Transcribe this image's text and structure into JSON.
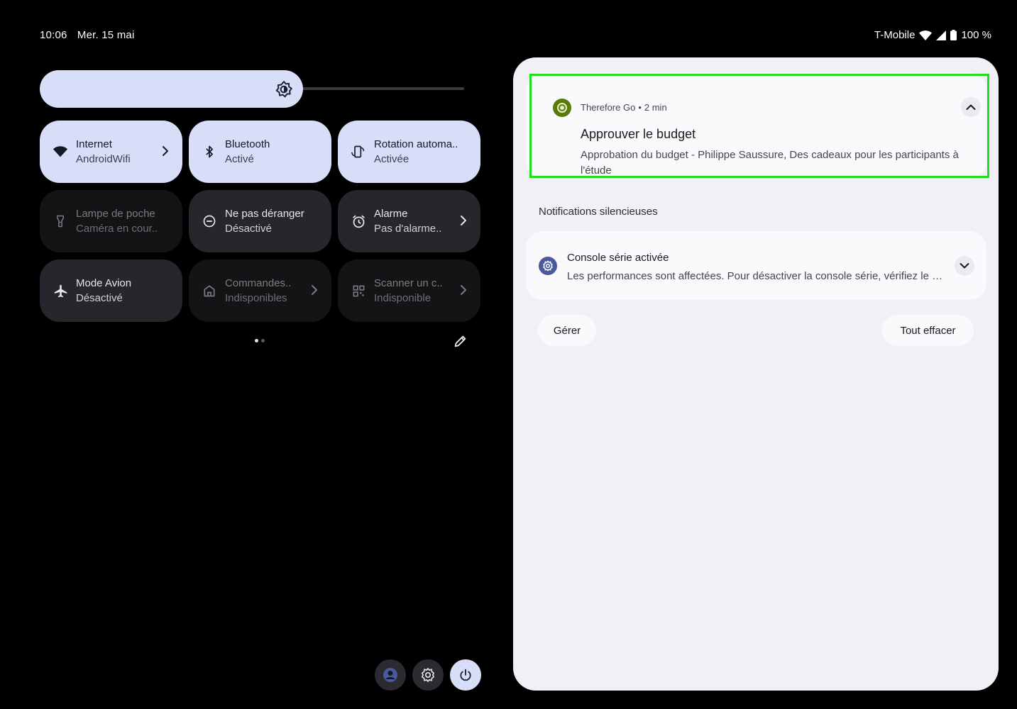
{
  "status_bar": {
    "time": "10:06",
    "date": "Mer. 15 mai",
    "carrier": "T-Mobile",
    "battery": "100 %"
  },
  "brightness": {
    "level": 0.62
  },
  "tiles": [
    {
      "title": "Internet",
      "subtitle": "AndroidWifi",
      "icon": "wifi-icon",
      "state": "on"
    },
    {
      "title": "Bluetooth",
      "subtitle": "Activé",
      "icon": "bluetooth-icon",
      "state": "on"
    },
    {
      "title": "Rotation automa..",
      "subtitle": "Activée",
      "icon": "rotation-icon",
      "state": "on"
    },
    {
      "title": "Lampe de poche",
      "subtitle": "Caméra en cour..",
      "icon": "flashlight-icon",
      "state": "unavailable"
    },
    {
      "title": "Ne pas déranger",
      "subtitle": "Désactivé",
      "icon": "dnd-icon",
      "state": "off"
    },
    {
      "title": "Alarme",
      "subtitle": "Pas d'alarme..",
      "icon": "alarm-icon",
      "state": "off"
    },
    {
      "title": "Mode Avion",
      "subtitle": "Désactivé",
      "icon": "airplane-icon",
      "state": "off"
    },
    {
      "title": "Commandes..",
      "subtitle": "Indisponibles",
      "icon": "home-icon",
      "state": "unavailable"
    },
    {
      "title": "Scanner un c..",
      "subtitle": "Indisponible",
      "icon": "qr-code-icon",
      "state": "unavailable"
    }
  ],
  "pager": {
    "pages": 2,
    "current": 1
  },
  "notification": {
    "app_name": "Therefore Go",
    "time_ago": "2 min",
    "separator": "•",
    "title": "Approuver le budget",
    "body": "Approbation du budget - Philippe Saussure, Des cadeaux pour les participants à l'étude",
    "app_color": "#5a7a0a"
  },
  "silent": {
    "section_label": "Notifications silencieuses",
    "title": "Console série activée",
    "body": "Les performances sont affectées. Pour désactiver la console série, vérifiez le bootloader."
  },
  "actions": {
    "manage": "Gérer",
    "clear_all": "Tout effacer"
  },
  "colors": {
    "tile_on": "#d8def8",
    "tile_off": "#26262c",
    "shade_bg": "#f2f0f6",
    "highlight": "#1ee01e"
  }
}
